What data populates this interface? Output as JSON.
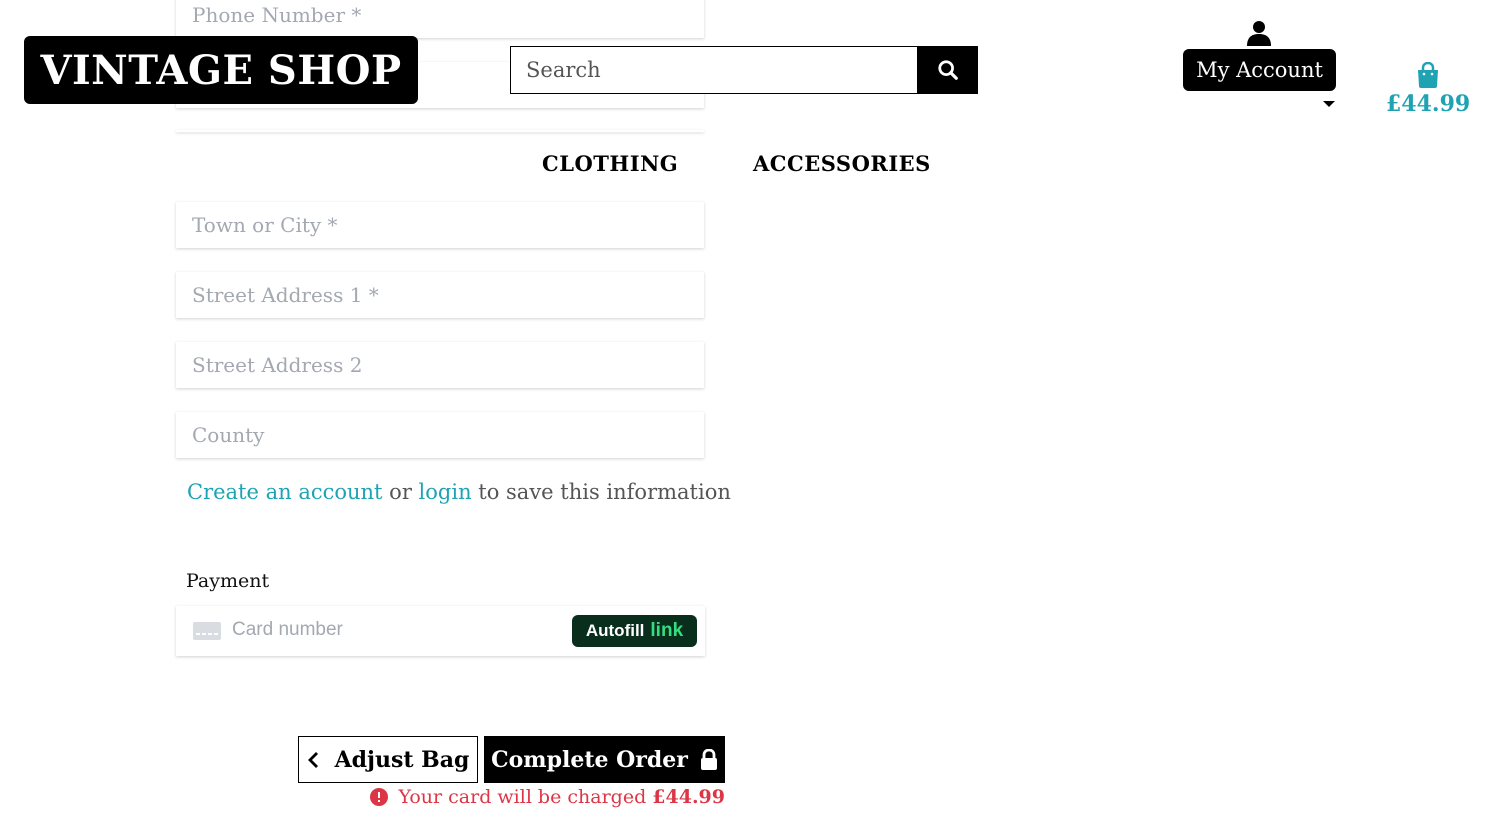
{
  "header": {
    "logo_text": "VINTAGE SHOP",
    "search_placeholder": "Search",
    "account_label": "My Account",
    "bag_total": "£44.99"
  },
  "nav": {
    "items": [
      {
        "label": "CLOTHING"
      },
      {
        "label": "ACCESSORIES"
      }
    ]
  },
  "form": {
    "fields": [
      {
        "placeholder": "Phone Number *",
        "value": ""
      },
      {
        "placeholder": "",
        "value": ""
      },
      {
        "placeholder": "",
        "value": ""
      },
      {
        "placeholder": "Town or City *",
        "value": ""
      },
      {
        "placeholder": "Street Address 1 *",
        "value": ""
      },
      {
        "placeholder": "Street Address 2",
        "value": ""
      },
      {
        "placeholder": "County",
        "value": ""
      }
    ],
    "save_info": {
      "create_link": "Create an account",
      "or_text": " or ",
      "login_link": "login",
      "suffix_text": " to save this information"
    }
  },
  "payment": {
    "label": "Payment",
    "card_placeholder": "Card number",
    "autofill_text": "Autofill",
    "autofill_link": "link"
  },
  "actions": {
    "adjust_label": "Adjust Bag",
    "complete_label": "Complete Order",
    "charge_prefix": "Your card will be charged ",
    "charge_amount": "£44.99"
  },
  "colors": {
    "accent": "#1fa3b3",
    "danger": "#dc3545",
    "link_green": "#33dd80",
    "autofill_bg": "#0a2e1c"
  }
}
